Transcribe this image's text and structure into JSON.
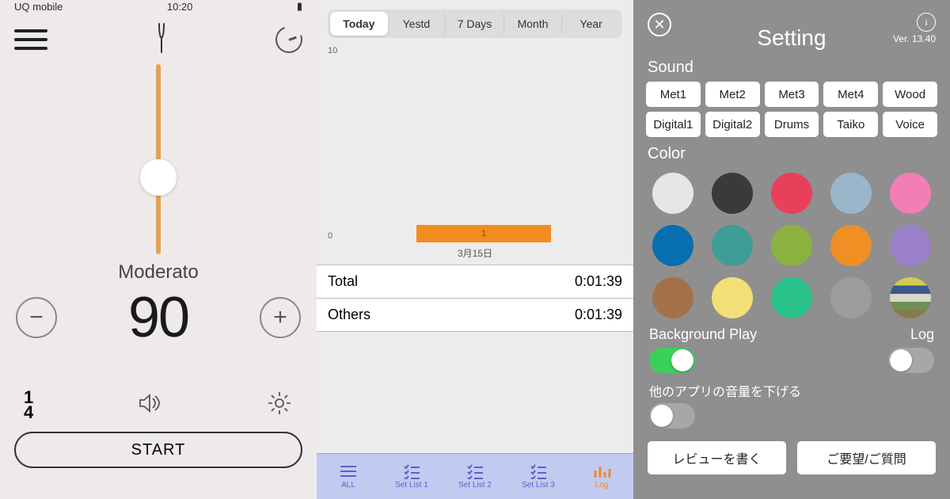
{
  "panel1": {
    "status_carrier": "UQ mobile",
    "status_time": "10:20",
    "tempo_name": "Moderato",
    "bpm": "90",
    "timesig_top": "1",
    "timesig_bot": "4",
    "start": "START"
  },
  "panel2": {
    "seg": [
      "Today",
      "Yestd",
      "7 Days",
      "Month",
      "Year"
    ],
    "y_max": "10",
    "y_min": "0",
    "bar_value": "1",
    "x_label": "3月15日",
    "rows": [
      {
        "label": "Total",
        "value": "0:01:39"
      },
      {
        "label": "Others",
        "value": "0:01:39"
      }
    ],
    "tabs": [
      "ALL",
      "Set List 1",
      "Set List 2",
      "Set List 3",
      "Log"
    ]
  },
  "panel3": {
    "title": "Setting",
    "version": "Ver. 13.40",
    "sound_label": "Sound",
    "sounds": [
      "Met1",
      "Met2",
      "Met3",
      "Met4",
      "Wood",
      "Digital1",
      "Digital2",
      "Drums",
      "Taiko",
      "Voice"
    ],
    "color_label": "Color",
    "colors": [
      "#e6e6e6",
      "#3a3a3a",
      "#e8405b",
      "#9ab6cb",
      "#f17fb6",
      "#076fb0",
      "#3f9d98",
      "#8bb23f",
      "#ef8f24",
      "#9b7fc9",
      "#a3724a",
      "#f3df78",
      "#29c28a",
      "#9c9c9c",
      "stripes"
    ],
    "bg_play_label": "Background Play",
    "log_label": "Log",
    "lower_vol_label": "他のアプリの音量を下げる",
    "review_btn": "レビューを書く",
    "feedback_btn": "ご要望/ご質問"
  },
  "chart_data": {
    "type": "bar",
    "categories": [
      "3月15日"
    ],
    "values": [
      1
    ],
    "ylim": [
      0,
      10
    ],
    "ylabel": "",
    "xlabel": "",
    "title": ""
  }
}
